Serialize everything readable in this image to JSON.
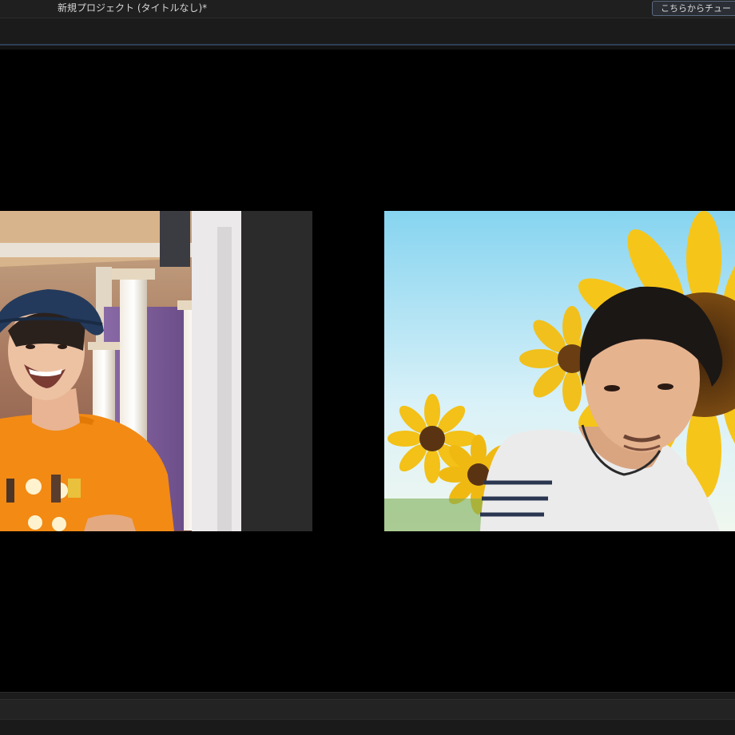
{
  "window": {
    "title": "新規プロジェクト (タイトルなし)*"
  },
  "header": {
    "tutorial_button_label": "こちらからチュー"
  },
  "colors": {
    "shirt_left": "#f28a14",
    "hat": "#233a5c",
    "sky": "#bfe6f4",
    "sunflower": "#f6c51a",
    "sunflower_center": "#5a3412",
    "shirt_right": "#ecebeb"
  }
}
